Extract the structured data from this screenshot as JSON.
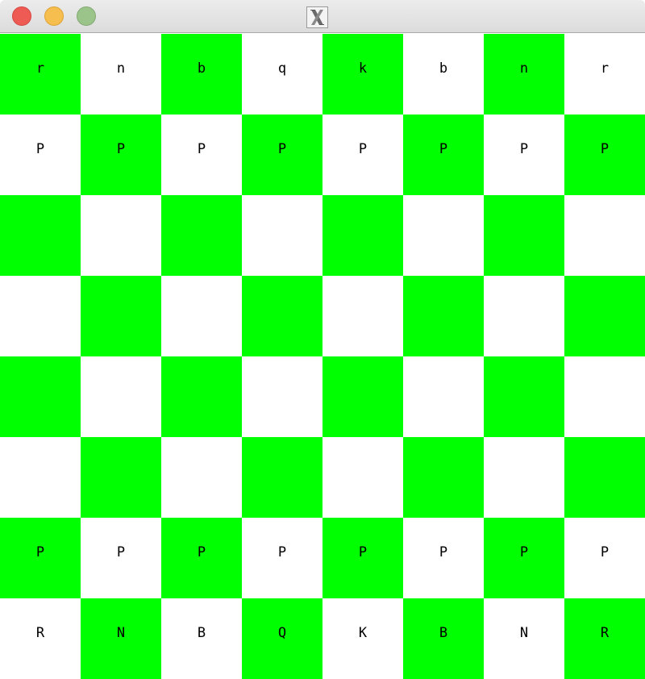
{
  "window": {
    "title": "",
    "app_icon": "x11-icon",
    "controls": [
      {
        "name": "close",
        "color": "#ee5b55",
        "border": "#d5463f"
      },
      {
        "name": "minimize",
        "color": "#f6be4f",
        "border": "#dea236"
      },
      {
        "name": "zoom",
        "color": "#9ac48a",
        "border": "#84aa74"
      }
    ]
  },
  "board": {
    "colors": {
      "light": "#ffffff",
      "dark": "#00ff00",
      "text": "#000000"
    },
    "ranks": [
      [
        "r",
        "n",
        "b",
        "q",
        "k",
        "b",
        "n",
        "r"
      ],
      [
        "P",
        "P",
        "P",
        "P",
        "P",
        "P",
        "P",
        "P"
      ],
      [
        "",
        "",
        "",
        "",
        "",
        "",
        "",
        ""
      ],
      [
        "",
        "",
        "",
        "",
        "",
        "",
        "",
        ""
      ],
      [
        "",
        "",
        "",
        "",
        "",
        "",
        "",
        ""
      ],
      [
        "",
        "",
        "",
        "",
        "",
        "",
        "",
        ""
      ],
      [
        "P",
        "P",
        "P",
        "P",
        "P",
        "P",
        "P",
        "P"
      ],
      [
        "R",
        "N",
        "B",
        "Q",
        "K",
        "B",
        "N",
        "R"
      ]
    ]
  }
}
